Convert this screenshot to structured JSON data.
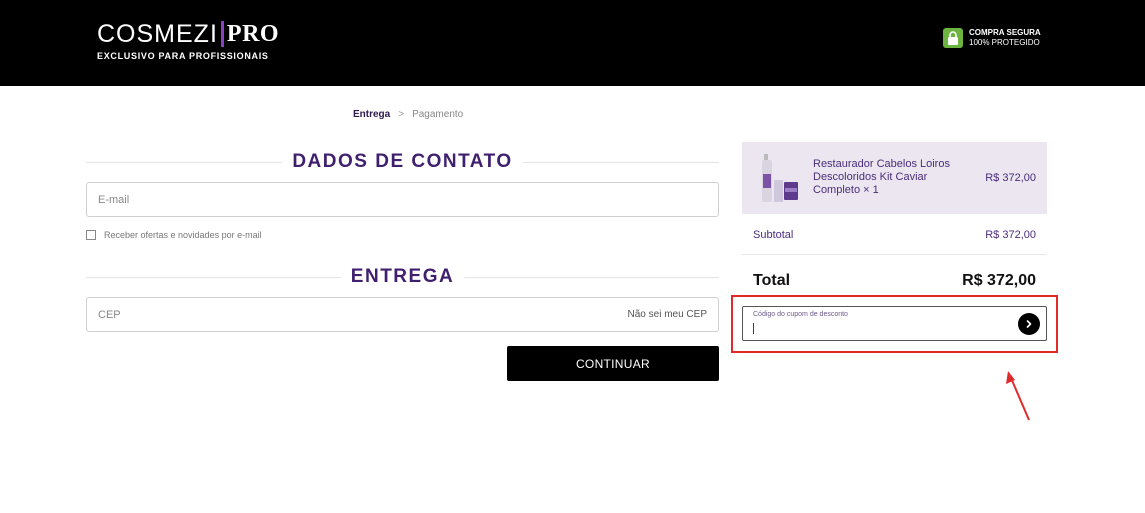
{
  "header": {
    "logo_main": "COSMEZI",
    "logo_pro": "PRO",
    "logo_sub": "EXCLUSIVO PARA PROFISSIONAIS",
    "secure_line1": "COMPRA SEGURA",
    "secure_line2": "100% PROTEGIDO"
  },
  "breadcrumb": {
    "active": "Entrega",
    "separator": ">",
    "next": "Pagamento"
  },
  "contact": {
    "title": "DADOS DE CONTATO",
    "email_placeholder": "E-mail",
    "newsletter_label": "Receber ofertas e novidades por e-mail"
  },
  "delivery": {
    "title": "ENTREGA",
    "cep_placeholder": "CEP",
    "cep_link": "Não sei meu CEP",
    "continue_label": "CONTINUAR"
  },
  "summary": {
    "product_name": "Restaurador Cabelos Loiros Descoloridos Kit Caviar Completo × 1",
    "product_price": "R$ 372,00",
    "subtotal_label": "Subtotal",
    "subtotal_value": "R$ 372,00",
    "total_label": "Total",
    "total_value": "R$ 372,00",
    "coupon_label": "Código do cupom de desconto"
  },
  "colors": {
    "brand_purple": "#3f1f6e",
    "accent_violet": "#8a3fc7",
    "secure_green": "#6db33f",
    "highlight_red": "#e02b2b"
  }
}
